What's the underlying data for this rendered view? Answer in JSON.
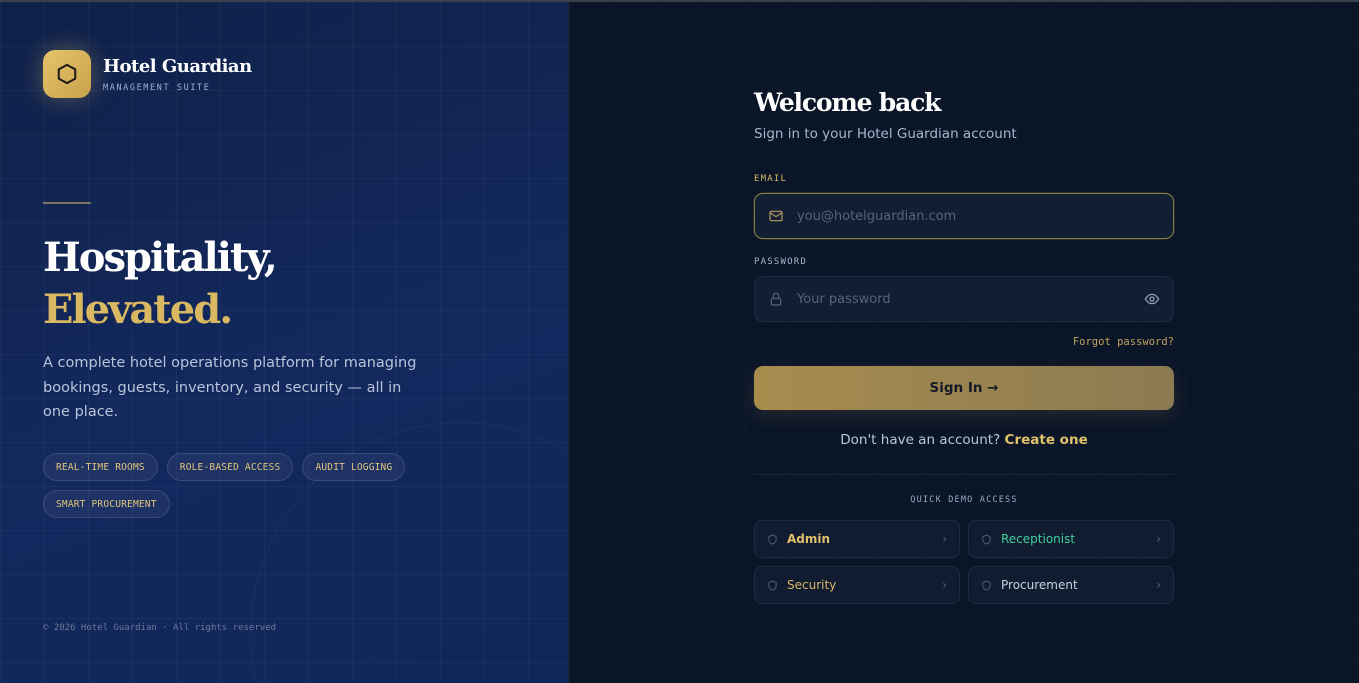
{
  "brand": {
    "name": "Hotel Guardian",
    "subtitle": "MANAGEMENT SUITE"
  },
  "hero": {
    "line1": "Hospitality,",
    "line2": "Elevated.",
    "description": "A complete hotel operations platform for managing bookings, guests, inventory, and security — all in one place."
  },
  "features": [
    "REAL-TIME ROOMS",
    "ROLE-BASED ACCESS",
    "AUDIT LOGGING",
    "SMART PROCUREMENT"
  ],
  "footer": {
    "copyright": "© 2026 Hotel Guardian · All rights reserved"
  },
  "login": {
    "title": "Welcome back",
    "subtitle": "Sign in to your Hotel Guardian account",
    "email_label": "EMAIL",
    "email_placeholder": "you@hotelguardian.com",
    "password_label": "PASSWORD",
    "password_placeholder": "Your password",
    "forgot": "Forgot password?",
    "signin_button": "Sign In →",
    "no_account_text": "Don't have an account?",
    "create_link": "Create one"
  },
  "quick_demo": {
    "title": "QUICK DEMO ACCESS",
    "roles": [
      {
        "label": "Admin",
        "color": "#e2c16b"
      },
      {
        "label": "Receptionist",
        "color": "#3fcf9a"
      },
      {
        "label": "Security",
        "color": "#d7b766"
      },
      {
        "label": "Procurement",
        "color": "#c9d2e3"
      }
    ]
  },
  "colors": {
    "accent_gold": "#d9b861",
    "panel_left": "#13295e",
    "panel_right": "#0a1528"
  },
  "icons": {
    "logo": "hexagon-icon",
    "email": "mail-icon",
    "password": "lock-icon",
    "show_password": "eye-icon",
    "demo_role": "shield-icon",
    "demo_arrow": "chevron-right-icon"
  }
}
